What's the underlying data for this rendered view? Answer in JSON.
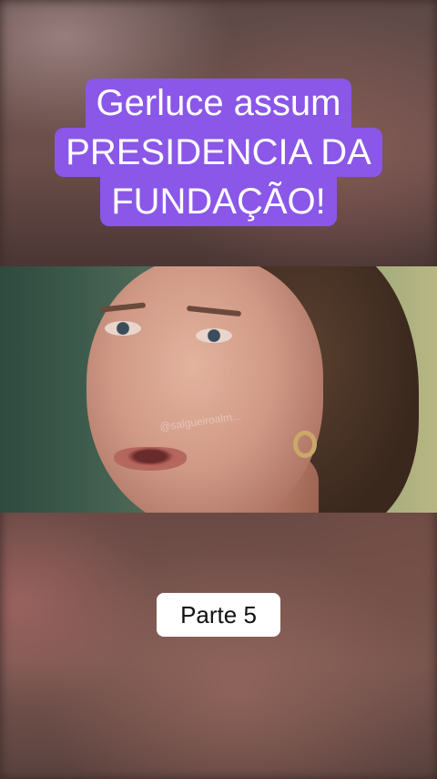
{
  "headline": {
    "line1": "Gerluce assum",
    "line2": "PRESIDENCIA DA",
    "line3": "FUNDAÇÃO!"
  },
  "part_label": "Parte 5",
  "watermark": "@salgueiroalm...",
  "colors": {
    "headline_bg": "#8a57e8",
    "headline_text": "#ffffff",
    "part_label_bg": "#ffffff",
    "part_label_text": "#111111"
  }
}
